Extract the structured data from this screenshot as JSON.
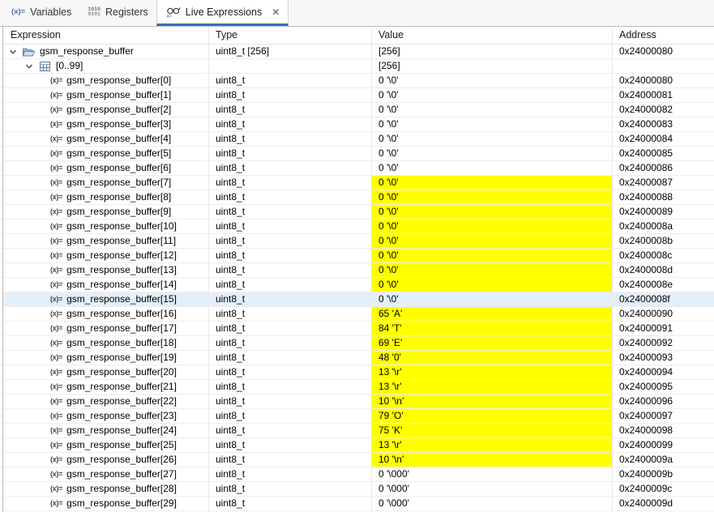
{
  "tabs": [
    {
      "label": "Variables",
      "icon": "expression-icon"
    },
    {
      "label": "Registers",
      "icon": "registers-icon"
    },
    {
      "label": "Live Expressions",
      "icon": "live-expressions-icon",
      "active": true,
      "closable": true
    }
  ],
  "icons": {
    "expression_glyph": "(x)=",
    "registers_glyph_top": "1010",
    "registers_glyph_bottom": "0101",
    "close_glyph": "✕"
  },
  "columns": {
    "expression": "Expression",
    "type": "Type",
    "value": "Value",
    "address": "Address"
  },
  "colors": {
    "value_changed_highlight": "#ffff00",
    "selected_row": "#e3f0fb",
    "active_tab_underline": "#3670b9"
  },
  "rows": [
    {
      "kind": "group",
      "level": 0,
      "icon": "folder-open",
      "expression": "gsm_response_buffer",
      "type": "uint8_t [256]",
      "value": "[256]",
      "address": "0x24000080",
      "highlight": false,
      "selected": false
    },
    {
      "kind": "group",
      "level": 1,
      "icon": "array",
      "expression": "[0..99]",
      "type": "",
      "value": "[256]",
      "address": "",
      "highlight": false,
      "selected": false
    },
    {
      "kind": "leaf",
      "level": 2,
      "icon": "expression",
      "expression": "gsm_response_buffer[0]",
      "type": "uint8_t",
      "value": "0 '\\0'",
      "address": "0x24000080",
      "highlight": false,
      "selected": false
    },
    {
      "kind": "leaf",
      "level": 2,
      "icon": "expression",
      "expression": "gsm_response_buffer[1]",
      "type": "uint8_t",
      "value": "0 '\\0'",
      "address": "0x24000081",
      "highlight": false,
      "selected": false
    },
    {
      "kind": "leaf",
      "level": 2,
      "icon": "expression",
      "expression": "gsm_response_buffer[2]",
      "type": "uint8_t",
      "value": "0 '\\0'",
      "address": "0x24000082",
      "highlight": false,
      "selected": false
    },
    {
      "kind": "leaf",
      "level": 2,
      "icon": "expression",
      "expression": "gsm_response_buffer[3]",
      "type": "uint8_t",
      "value": "0 '\\0'",
      "address": "0x24000083",
      "highlight": false,
      "selected": false
    },
    {
      "kind": "leaf",
      "level": 2,
      "icon": "expression",
      "expression": "gsm_response_buffer[4]",
      "type": "uint8_t",
      "value": "0 '\\0'",
      "address": "0x24000084",
      "highlight": false,
      "selected": false
    },
    {
      "kind": "leaf",
      "level": 2,
      "icon": "expression",
      "expression": "gsm_response_buffer[5]",
      "type": "uint8_t",
      "value": "0 '\\0'",
      "address": "0x24000085",
      "highlight": false,
      "selected": false
    },
    {
      "kind": "leaf",
      "level": 2,
      "icon": "expression",
      "expression": "gsm_response_buffer[6]",
      "type": "uint8_t",
      "value": "0 '\\0'",
      "address": "0x24000086",
      "highlight": false,
      "selected": false
    },
    {
      "kind": "leaf",
      "level": 2,
      "icon": "expression",
      "expression": "gsm_response_buffer[7]",
      "type": "uint8_t",
      "value": "0 '\\0'",
      "address": "0x24000087",
      "highlight": true,
      "selected": false
    },
    {
      "kind": "leaf",
      "level": 2,
      "icon": "expression",
      "expression": "gsm_response_buffer[8]",
      "type": "uint8_t",
      "value": "0 '\\0'",
      "address": "0x24000088",
      "highlight": true,
      "selected": false
    },
    {
      "kind": "leaf",
      "level": 2,
      "icon": "expression",
      "expression": "gsm_response_buffer[9]",
      "type": "uint8_t",
      "value": "0 '\\0'",
      "address": "0x24000089",
      "highlight": true,
      "selected": false
    },
    {
      "kind": "leaf",
      "level": 2,
      "icon": "expression",
      "expression": "gsm_response_buffer[10]",
      "type": "uint8_t",
      "value": "0 '\\0'",
      "address": "0x2400008a",
      "highlight": true,
      "selected": false
    },
    {
      "kind": "leaf",
      "level": 2,
      "icon": "expression",
      "expression": "gsm_response_buffer[11]",
      "type": "uint8_t",
      "value": "0 '\\0'",
      "address": "0x2400008b",
      "highlight": true,
      "selected": false
    },
    {
      "kind": "leaf",
      "level": 2,
      "icon": "expression",
      "expression": "gsm_response_buffer[12]",
      "type": "uint8_t",
      "value": "0 '\\0'",
      "address": "0x2400008c",
      "highlight": true,
      "selected": false
    },
    {
      "kind": "leaf",
      "level": 2,
      "icon": "expression",
      "expression": "gsm_response_buffer[13]",
      "type": "uint8_t",
      "value": "0 '\\0'",
      "address": "0x2400008d",
      "highlight": true,
      "selected": false
    },
    {
      "kind": "leaf",
      "level": 2,
      "icon": "expression",
      "expression": "gsm_response_buffer[14]",
      "type": "uint8_t",
      "value": "0 '\\0'",
      "address": "0x2400008e",
      "highlight": true,
      "selected": false
    },
    {
      "kind": "leaf",
      "level": 2,
      "icon": "expression",
      "expression": "gsm_response_buffer[15]",
      "type": "uint8_t",
      "value": "0 '\\0'",
      "address": "0x2400008f",
      "highlight": false,
      "selected": true
    },
    {
      "kind": "leaf",
      "level": 2,
      "icon": "expression",
      "expression": "gsm_response_buffer[16]",
      "type": "uint8_t",
      "value": "65 'A'",
      "address": "0x24000090",
      "highlight": true,
      "selected": false
    },
    {
      "kind": "leaf",
      "level": 2,
      "icon": "expression",
      "expression": "gsm_response_buffer[17]",
      "type": "uint8_t",
      "value": "84 'T'",
      "address": "0x24000091",
      "highlight": true,
      "selected": false
    },
    {
      "kind": "leaf",
      "level": 2,
      "icon": "expression",
      "expression": "gsm_response_buffer[18]",
      "type": "uint8_t",
      "value": "69 'E'",
      "address": "0x24000092",
      "highlight": true,
      "selected": false
    },
    {
      "kind": "leaf",
      "level": 2,
      "icon": "expression",
      "expression": "gsm_response_buffer[19]",
      "type": "uint8_t",
      "value": "48 '0'",
      "address": "0x24000093",
      "highlight": true,
      "selected": false
    },
    {
      "kind": "leaf",
      "level": 2,
      "icon": "expression",
      "expression": "gsm_response_buffer[20]",
      "type": "uint8_t",
      "value": "13 '\\r'",
      "address": "0x24000094",
      "highlight": true,
      "selected": false
    },
    {
      "kind": "leaf",
      "level": 2,
      "icon": "expression",
      "expression": "gsm_response_buffer[21]",
      "type": "uint8_t",
      "value": "13 '\\r'",
      "address": "0x24000095",
      "highlight": true,
      "selected": false
    },
    {
      "kind": "leaf",
      "level": 2,
      "icon": "expression",
      "expression": "gsm_response_buffer[22]",
      "type": "uint8_t",
      "value": "10 '\\n'",
      "address": "0x24000096",
      "highlight": true,
      "selected": false
    },
    {
      "kind": "leaf",
      "level": 2,
      "icon": "expression",
      "expression": "gsm_response_buffer[23]",
      "type": "uint8_t",
      "value": "79 'O'",
      "address": "0x24000097",
      "highlight": true,
      "selected": false
    },
    {
      "kind": "leaf",
      "level": 2,
      "icon": "expression",
      "expression": "gsm_response_buffer[24]",
      "type": "uint8_t",
      "value": "75 'K'",
      "address": "0x24000098",
      "highlight": true,
      "selected": false
    },
    {
      "kind": "leaf",
      "level": 2,
      "icon": "expression",
      "expression": "gsm_response_buffer[25]",
      "type": "uint8_t",
      "value": "13 '\\r'",
      "address": "0x24000099",
      "highlight": true,
      "selected": false
    },
    {
      "kind": "leaf",
      "level": 2,
      "icon": "expression",
      "expression": "gsm_response_buffer[26]",
      "type": "uint8_t",
      "value": "10 '\\n'",
      "address": "0x2400009a",
      "highlight": true,
      "selected": false
    },
    {
      "kind": "leaf",
      "level": 2,
      "icon": "expression",
      "expression": "gsm_response_buffer[27]",
      "type": "uint8_t",
      "value": "0 '\\000'",
      "address": "0x2400009b",
      "highlight": false,
      "selected": false
    },
    {
      "kind": "leaf",
      "level": 2,
      "icon": "expression",
      "expression": "gsm_response_buffer[28]",
      "type": "uint8_t",
      "value": "0 '\\000'",
      "address": "0x2400009c",
      "highlight": false,
      "selected": false
    },
    {
      "kind": "leaf",
      "level": 2,
      "icon": "expression",
      "expression": "gsm_response_buffer[29]",
      "type": "uint8_t",
      "value": "0 '\\000'",
      "address": "0x2400009d",
      "highlight": false,
      "selected": false
    }
  ]
}
